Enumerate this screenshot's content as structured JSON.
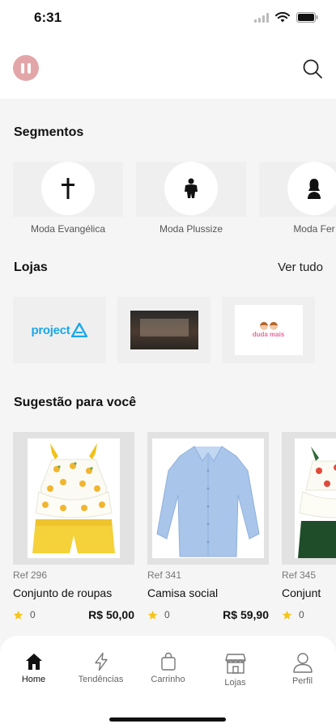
{
  "status_bar": {
    "time": "6:31"
  },
  "header": {
    "logo_icon": "pause-logo-icon",
    "search_icon": "search-icon"
  },
  "segments": {
    "title": "Segmentos",
    "items": [
      {
        "label": "Moda Evangélica",
        "icon": "cross-icon"
      },
      {
        "label": "Moda Plussize",
        "icon": "plus-size-figure-icon"
      },
      {
        "label": "Moda Fer",
        "icon": "woman-figure-icon"
      }
    ]
  },
  "stores": {
    "title": "Lojas",
    "see_all": "Ver tudo",
    "items": [
      {
        "name": "project",
        "type": "logo"
      },
      {
        "name": "",
        "type": "photo"
      },
      {
        "name": "duda mais",
        "type": "logo"
      }
    ]
  },
  "suggestions": {
    "title": "Sugestão para você",
    "products": [
      {
        "ref": "Ref 296",
        "name": "Conjunto de roupas",
        "rating": "0",
        "price": "R$ 50,00"
      },
      {
        "ref": "Ref 341",
        "name": "Camisa social",
        "rating": "0",
        "price": "R$ 59,90"
      },
      {
        "ref": "Ref 345",
        "name": "Conjunt",
        "rating": "0",
        "price": ""
      }
    ]
  },
  "nav": {
    "items": [
      {
        "label": "Home",
        "icon": "home-icon",
        "active": true
      },
      {
        "label": "Tendências",
        "icon": "lightning-icon",
        "active": false
      },
      {
        "label": "Carrinho",
        "icon": "shopping-bag-icon",
        "active": false
      },
      {
        "label": "Lojas",
        "icon": "store-icon",
        "active": false
      },
      {
        "label": "Perfil",
        "icon": "user-icon",
        "active": false
      }
    ]
  },
  "colors": {
    "accent_logo": "#e3a6a8",
    "star": "#f5c518",
    "store_project": "#1aa7ec"
  }
}
